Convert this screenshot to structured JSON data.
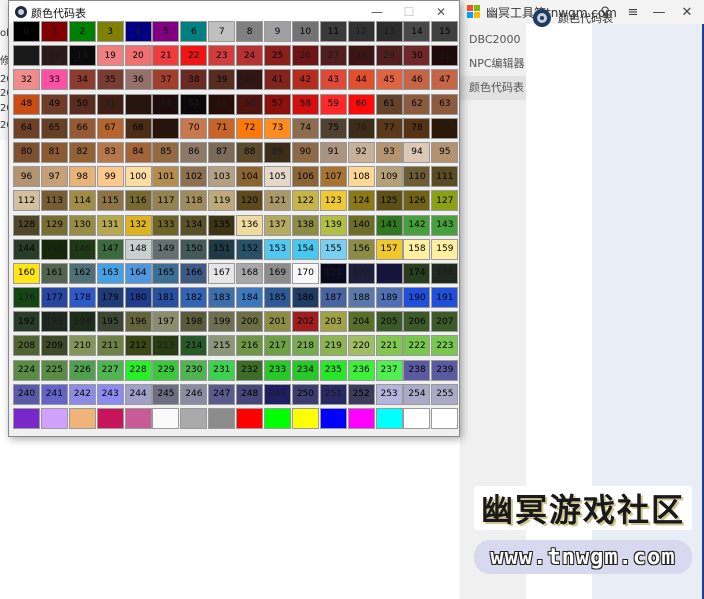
{
  "background_app": {
    "title": "幽冥工具箱tnwgm.com",
    "controls": {
      "search": "⚲",
      "menu": "≡",
      "minimize": "—",
      "close": "✕"
    },
    "nav": [
      {
        "label": "DBC2000",
        "active": false
      },
      {
        "label": "NPC编辑器",
        "active": false
      },
      {
        "label": "颜色代码表",
        "active": true
      }
    ],
    "page_title": "颜色代码表",
    "watermark_cn": "幽冥游戏社区",
    "watermark_url": "www.tnwgm.com"
  },
  "left_window_fragments": [
    "olar",
    "修",
    "20",
    "20",
    "20",
    "20"
  ],
  "dialog": {
    "title": "颜色代码表",
    "controls": {
      "minimize": "—",
      "maximize": "☐",
      "close": "✕"
    }
  },
  "palette": [
    [
      "#000000",
      "#800000",
      "#008000",
      "#808000",
      "#000080",
      "#800080",
      "#008080",
      "#c0c0c0",
      "#808080",
      "#a0a0a4",
      "#737373",
      "#3a3a3a",
      "#303030",
      "#2c2c2c",
      "#484848",
      "#3f3f3f"
    ],
    [
      "#1a1a1a",
      "#2a1a1a",
      "#0a0a0a",
      "#f08080",
      "#f07070",
      "#f03c3c",
      "#f01414",
      "#d23c3c",
      "#b43232",
      "#8c1e1e",
      "#6e1414",
      "#501e1e",
      "#3c1414",
      "#501e1e",
      "#6e2828",
      "#1e0a0a"
    ],
    [
      "#f08c8c",
      "#ff4fa6",
      "#8a3c2e",
      "#7a3c32",
      "#96706a",
      "#a0402c",
      "#6a2a24",
      "#582c20",
      "#321616",
      "#82241c",
      "#b42c1c",
      "#e04838",
      "#e0502c",
      "#e06442",
      "#c86446",
      "#c86446"
    ],
    [
      "#c84c14",
      "#6e3c28",
      "#5a2c20",
      "#401e14",
      "#2a1410",
      "#1e0c0c",
      "#0a0808",
      "#280c08",
      "#501410",
      "#8c100c",
      "#d21010",
      "#ff2828",
      "#ff0a0a",
      "#64422c",
      "#8c5a3c",
      "#8c5a3c"
    ],
    [
      "#6e4028",
      "#644024",
      "#965a32",
      "#b4642c",
      "#4c2c14",
      "#281408",
      "#c8784a",
      "#c86428",
      "#ff780a",
      "#ff8c1e",
      "#8c6c4c",
      "#504030",
      "#3c2c18",
      "#5a381a",
      "#543414",
      "#2c1806"
    ],
    [
      "#7c5030",
      "#8a5a32",
      "#926236",
      "#b4784a",
      "#a06438",
      "#946a42",
      "#8c7a66",
      "#7a6a56",
      "#5c4a2c",
      "#3c2c1a",
      "#8c6a46",
      "#aa9480",
      "#c8b09a",
      "#b49470",
      "#dcc8b4",
      "#b49270"
    ],
    [
      "#b49470",
      "#c8a078",
      "#e6b478",
      "#ffc88c",
      "#ffdca0",
      "#b48c50",
      "#8c7050",
      "#b4a082",
      "#8c6432",
      "#e6d8c8",
      "#8c6434",
      "#a87432",
      "#ffd896",
      "#b4a078",
      "#6e5c34",
      "#5a4a22"
    ],
    [
      "#d2c0a0",
      "#785c34",
      "#a08c46",
      "#8c7446",
      "#786832",
      "#968250",
      "#a08c5a",
      "#beaa78",
      "#5c4a1e",
      "#aa9868",
      "#c8b446",
      "#f0c832",
      "#8c7814",
      "#5c5014",
      "#6e6414",
      "#8ca014"
    ],
    [
      "#504628",
      "#786e32",
      "#968c46",
      "#b4a850",
      "#dcb41e",
      "#6e6428",
      "#5a5028",
      "#3c3414",
      "#f0dca0",
      "#b4aa64",
      "#8c8c46",
      "#b4be46",
      "#6e6e28",
      "#32781e",
      "#46a03c",
      "#46a03c"
    ],
    [
      "#283c28",
      "#14280a",
      "#1e3a14",
      "#3c6a3c",
      "#c8d0d0",
      "#647070",
      "#425a5a",
      "#1e3a46",
      "#285068",
      "#50c8f0",
      "#46c8f0",
      "#78d0f0",
      "#8c8c46",
      "#f0c82a",
      "#fff0a0",
      "#fff0a0"
    ],
    [
      "#ffe614",
      "#506450",
      "#4e6e78",
      "#46a0e6",
      "#5096dc",
      "#3c6e96",
      "#3c5a82",
      "#e6e6e6",
      "#a8a8a8",
      "#8c8c8c",
      "#f8f8f8",
      "#0a0a1e",
      "#1e1e3c",
      "#14143c",
      "#283c1e",
      "#1e281e"
    ],
    [
      "#144614",
      "#2846a0",
      "#2d5ac8",
      "#1e3c78",
      "#1e3c8c",
      "#2850a0",
      "#3264b4",
      "#3c6eaa",
      "#3c78be",
      "#2e5a96",
      "#1e3c64",
      "#4664a0",
      "#5a78aa",
      "#506eb4",
      "#1e50dc",
      "#1e50dc"
    ],
    [
      "#283c28",
      "#1e281e",
      "#1e2c1a",
      "#3c4632",
      "#64643c",
      "#8c8c6e",
      "#5a5a3c",
      "#6e6e50",
      "#6e6e46",
      "#8c8c46",
      "#a01e1e",
      "#a0a046",
      "#5a6e2c",
      "#3c5a28",
      "#3c5a28",
      "#3c5a28"
    ],
    [
      "#506432",
      "#3c4a28",
      "#82965a",
      "#6e8246",
      "#3c4614",
      "#283c14",
      "#285a28",
      "#8c9678",
      "#6e9646",
      "#6ea046",
      "#78aa50",
      "#8cb450",
      "#a0be64",
      "#82c850",
      "#78c850",
      "#78c850"
    ],
    [
      "#5a8c46",
      "#5a8c46",
      "#50a050",
      "#50b450",
      "#28f028",
      "#3cc83c",
      "#50b450",
      "#3cd250",
      "#3c6e28",
      "#28c828",
      "#28c828",
      "#28e628",
      "#3cf03c",
      "#50f050",
      "#5a5aa0",
      "#5a5aa0"
    ],
    [
      "#5a5aaa",
      "#6464c8",
      "#8c8ce6",
      "#8c8cf0",
      "#a0a0c8",
      "#6e6e82",
      "#8c8ca0",
      "#5a5a8c",
      "#464678",
      "#1e1e64",
      "#3c3c6e",
      "#282864",
      "#3c3c5a",
      "#b4b4dc",
      "#aaaac8",
      "#aaaac8"
    ],
    [
      "#7828c8",
      "#d2a0ff",
      "#f0b478",
      "#c8145a",
      "#c85a96",
      "#fafafa",
      "#aaaaaa",
      "#8c8c8c",
      "#ff0000",
      "#00ff00",
      "#ffff00",
      "#0000ff",
      "#ff00ff",
      "#00ffff",
      "#ffffff",
      "#ffffff"
    ]
  ],
  "palette_labels": [
    "0",
    "1",
    "2",
    "3",
    "4",
    "5",
    "6",
    "7",
    "8",
    "9",
    "10",
    "11",
    "12",
    "13",
    "14",
    "15",
    "16",
    "17",
    "18",
    "19",
    "20",
    "21",
    "22",
    "23",
    "24",
    "25",
    "26",
    "27",
    "28",
    "29",
    "30",
    "31",
    "32",
    "33",
    "34",
    "35",
    "36",
    "37",
    "38",
    "39",
    "40",
    "41",
    "42",
    "43",
    "44",
    "45",
    "46",
    "47",
    "48",
    "49",
    "50",
    "51",
    "52",
    "53",
    "54",
    "55",
    "56",
    "57",
    "58",
    "59",
    "60",
    "61",
    "62",
    "63",
    "64",
    "65",
    "66",
    "67",
    "68",
    "69",
    "70",
    "71",
    "72",
    "73",
    "74",
    "75",
    "76",
    "77",
    "78",
    "79",
    "80",
    "81",
    "82",
    "83",
    "84",
    "85",
    "86",
    "87",
    "88",
    "89",
    "90",
    "91",
    "92",
    "93",
    "94",
    "95",
    "96",
    "97",
    "98",
    "99",
    "100",
    "101",
    "102",
    "103",
    "104",
    "105",
    "106",
    "107",
    "108",
    "109",
    "110",
    "111",
    "112",
    "113",
    "114",
    "115",
    "116",
    "117",
    "118",
    "119",
    "120",
    "121",
    "122",
    "123",
    "124",
    "125",
    "126",
    "127",
    "128",
    "129",
    "130",
    "131",
    "132",
    "133",
    "134",
    "135",
    "136",
    "137",
    "138",
    "139",
    "140",
    "141",
    "142",
    "143",
    "144",
    "145",
    "146",
    "147",
    "148",
    "149",
    "150",
    "151",
    "152",
    "153",
    "154",
    "155",
    "156",
    "157",
    "158",
    "159",
    "160",
    "161",
    "162",
    "163",
    "164",
    "165",
    "166",
    "167",
    "168",
    "169",
    "170",
    "171",
    "172",
    "173",
    "174",
    "175",
    "176",
    "177",
    "178",
    "179",
    "180",
    "181",
    "182",
    "183",
    "184",
    "185",
    "186",
    "187",
    "188",
    "189",
    "190",
    "191",
    "192",
    "193",
    "194",
    "195",
    "196",
    "197",
    "198",
    "199",
    "200",
    "201",
    "202",
    "203",
    "204",
    "205",
    "206",
    "207",
    "208",
    "209",
    "210",
    "211",
    "212",
    "213",
    "214",
    "215",
    "216",
    "217",
    "218",
    "219",
    "220",
    "221",
    "222",
    "223",
    "224",
    "225",
    "226",
    "227",
    "228",
    "229",
    "230",
    "231",
    "232",
    "233",
    "234",
    "235",
    "236",
    "237",
    "238",
    "239",
    "240",
    "241",
    "242",
    "243",
    "244",
    "245",
    "246",
    "247",
    "248",
    "249",
    "250",
    "251",
    "252",
    "253",
    "254",
    "255"
  ]
}
